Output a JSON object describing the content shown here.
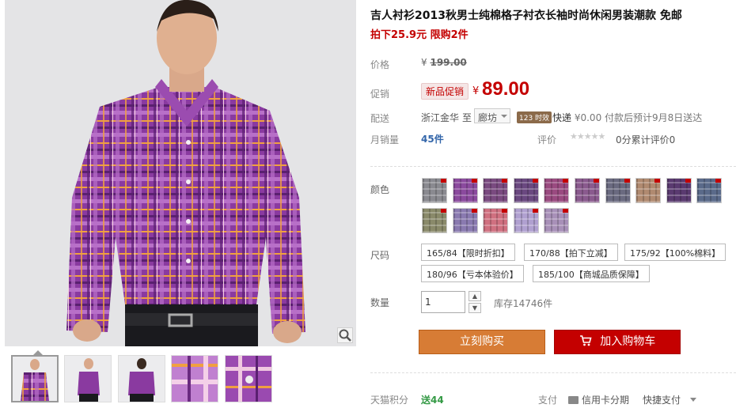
{
  "product": {
    "title": "吉人衬衫2013秋男士纯棉格子衬衣长袖时尚休闲男装潮款 免邮",
    "promo": "拍下25.9元 限购2件"
  },
  "price": {
    "label": "价格",
    "yen": "¥",
    "original": "199.00"
  },
  "promotion": {
    "label": "促销",
    "tag": "新品促销",
    "yen": "¥",
    "price": "89.00"
  },
  "shipping": {
    "label": "配送",
    "from": "浙江金华",
    "to_label": "至",
    "destination": "廊坊",
    "badge": "123 时效",
    "method": "快递",
    "fee": "¥0.00",
    "note": "付款后预计9月8日送达"
  },
  "sales": {
    "label": "月销量",
    "count": "45件",
    "rating_label": "评价",
    "stars": "★★★★★",
    "rating_text": "0分累计评价0"
  },
  "colors": {
    "label": "颜色",
    "swatches": [
      {
        "icon": "plaid-shirt-gray",
        "color": "#8a8a90"
      },
      {
        "icon": "plaid-shirt-purple",
        "color": "#8b4a9e"
      },
      {
        "icon": "plaid-shirt-purple-dark",
        "color": "#7a4a80"
      },
      {
        "icon": "plaid-shirt-violet",
        "color": "#6a4880"
      },
      {
        "icon": "plaid-shirt-magenta",
        "color": "#9a4a80"
      },
      {
        "icon": "plaid-shirt-plum",
        "color": "#8a5a8e"
      },
      {
        "icon": "plaid-shirt-slate",
        "color": "#6a6a80"
      },
      {
        "icon": "plaid-shirt-tan",
        "color": "#b08a70"
      },
      {
        "icon": "plaid-shirt-deep-purple",
        "color": "#5a3a70"
      },
      {
        "icon": "plaid-shirt-blue",
        "color": "#5a6a8a"
      },
      {
        "icon": "plaid-shirt-olive",
        "color": "#8a8a6a"
      },
      {
        "icon": "plaid-shirt-lavender",
        "color": "#8a7ab0"
      },
      {
        "icon": "plaid-shirt-pink",
        "color": "#d07080"
      },
      {
        "icon": "plaid-shirt-lilac",
        "color": "#b0a0d0"
      },
      {
        "icon": "plaid-shirt-light-purple",
        "color": "#a890b8"
      }
    ]
  },
  "sizes": {
    "label": "尺码",
    "options": [
      "165/84【限时折扣】",
      "170/88【拍下立减】",
      "175/92【100%棉料】",
      "180/96【亏本体验价】",
      "185/100【商城品质保障】"
    ]
  },
  "quantity": {
    "label": "数量",
    "value": "1",
    "up": "▲",
    "down": "▼",
    "stock": "库存14746件"
  },
  "actions": {
    "buy_now": "立刻购买",
    "add_to_cart": "加入购物车"
  },
  "footer": {
    "points_label": "天猫积分",
    "points": "送44",
    "pay_label": "支付",
    "credit_card": "信用卡分期",
    "quick_pay": "快捷支付"
  },
  "theme": {
    "accent_red": "#c40000",
    "buy_orange": "#d77c35",
    "shirt_purple": "#8b3fa0"
  }
}
